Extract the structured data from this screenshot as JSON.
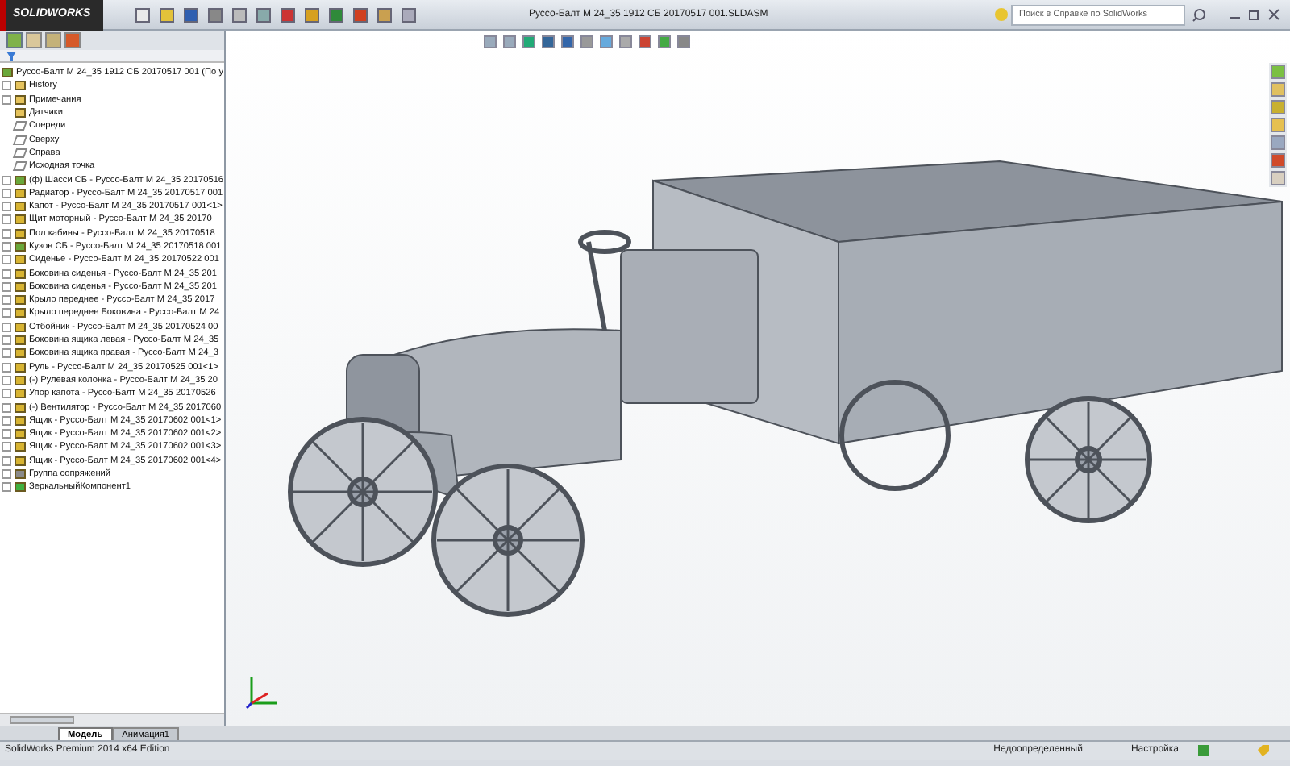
{
  "app": {
    "logo": "SOLIDWORKS",
    "title": "Руссо-Балт М 24_35 1912 СБ  20170517 001.SLDASM",
    "search": {
      "placeholder": "Поиск в Справке по SolidWorks"
    }
  },
  "tree": {
    "root": "Руссо-Балт М 24_35 1912 СБ  20170517 001  (По у",
    "items": [
      {
        "kind": "folder",
        "label": "History",
        "expander": true
      },
      {
        "kind": "folder",
        "label": "Примечания",
        "expander": true
      },
      {
        "kind": "folder",
        "label": "Датчики",
        "expander": false
      },
      {
        "kind": "plane",
        "label": "Спереди",
        "expander": false
      },
      {
        "kind": "plane",
        "label": "Сверху",
        "expander": false
      },
      {
        "kind": "plane",
        "label": "Справа",
        "expander": false
      },
      {
        "kind": "origin",
        "label": "Исходная точка",
        "expander": false
      },
      {
        "kind": "assembly",
        "label": "(ф) Шасси СБ - Руссо-Балт М 24_35  20170516",
        "expander": true
      },
      {
        "kind": "part",
        "label": "Радиатор - Руссо-Балт М 24_35  20170517 001",
        "expander": true
      },
      {
        "kind": "part",
        "label": "Капот - Руссо-Балт М 24_35  20170517 001<1>",
        "expander": true
      },
      {
        "kind": "part",
        "label": "Щит моторный - Руссо-Балт М 24_35  20170",
        "expander": true
      },
      {
        "kind": "part",
        "label": "Пол кабины - Руссо-Балт М 24_35  20170518",
        "expander": true
      },
      {
        "kind": "assembly",
        "label": "Кузов СБ - Руссо-Балт М 24_35  20170518 001",
        "expander": true
      },
      {
        "kind": "part",
        "label": "Сиденье - Руссо-Балт М 24_35  20170522 001",
        "expander": true
      },
      {
        "kind": "part",
        "label": "Боковина сиденья - Руссо-Балт М 24_35  201",
        "expander": true
      },
      {
        "kind": "part",
        "label": "Боковина сиденья - Руссо-Балт М 24_35  201",
        "expander": true
      },
      {
        "kind": "part",
        "label": "Крыло переднее - Руссо-Балт М 24_35  2017",
        "expander": true
      },
      {
        "kind": "part",
        "label": "Крыло переднее Боковина - Руссо-Балт М 24",
        "expander": true
      },
      {
        "kind": "part",
        "label": "Отбойник - Руссо-Балт М 24_35  20170524 00",
        "expander": true
      },
      {
        "kind": "part",
        "label": "Боковина ящика левая - Руссо-Балт М 24_35",
        "expander": true
      },
      {
        "kind": "part",
        "label": "Боковина ящика правая - Руссо-Балт М 24_3",
        "expander": true
      },
      {
        "kind": "part",
        "label": "Руль - Руссо-Балт М 24_35  20170525 001<1>",
        "expander": true
      },
      {
        "kind": "part",
        "label": "(-) Рулевая колонка - Руссо-Балт М 24_35  20",
        "expander": true
      },
      {
        "kind": "part",
        "label": "Упор капота - Руссо-Балт М 24_35  20170526",
        "expander": true
      },
      {
        "kind": "part",
        "label": "(-) Вентилятор - Руссо-Балт М 24_35  2017060",
        "expander": true
      },
      {
        "kind": "part",
        "label": "Ящик - Руссо-Балт М 24_35  20170602 001<1>",
        "expander": true
      },
      {
        "kind": "part",
        "label": "Ящик - Руссо-Балт М 24_35  20170602 001<2>",
        "expander": true
      },
      {
        "kind": "part",
        "label": "Ящик - Руссо-Балт М 24_35  20170602 001<3>",
        "expander": true
      },
      {
        "kind": "part",
        "label": "Ящик - Руссо-Балт М 24_35  20170602 001<4>",
        "expander": true
      },
      {
        "kind": "mates",
        "label": "Группа сопряжений",
        "expander": true
      },
      {
        "kind": "mirror",
        "label": "ЗеркальныйКомпонент1",
        "expander": true
      }
    ]
  },
  "tabs": [
    {
      "label": "Модель",
      "selected": true
    },
    {
      "label": "Анимация1",
      "selected": false
    }
  ],
  "status_bar": {
    "edition": "SolidWorks Premium 2014 x64 Edition",
    "state": "Недоопределенный",
    "units": "Настройка"
  }
}
